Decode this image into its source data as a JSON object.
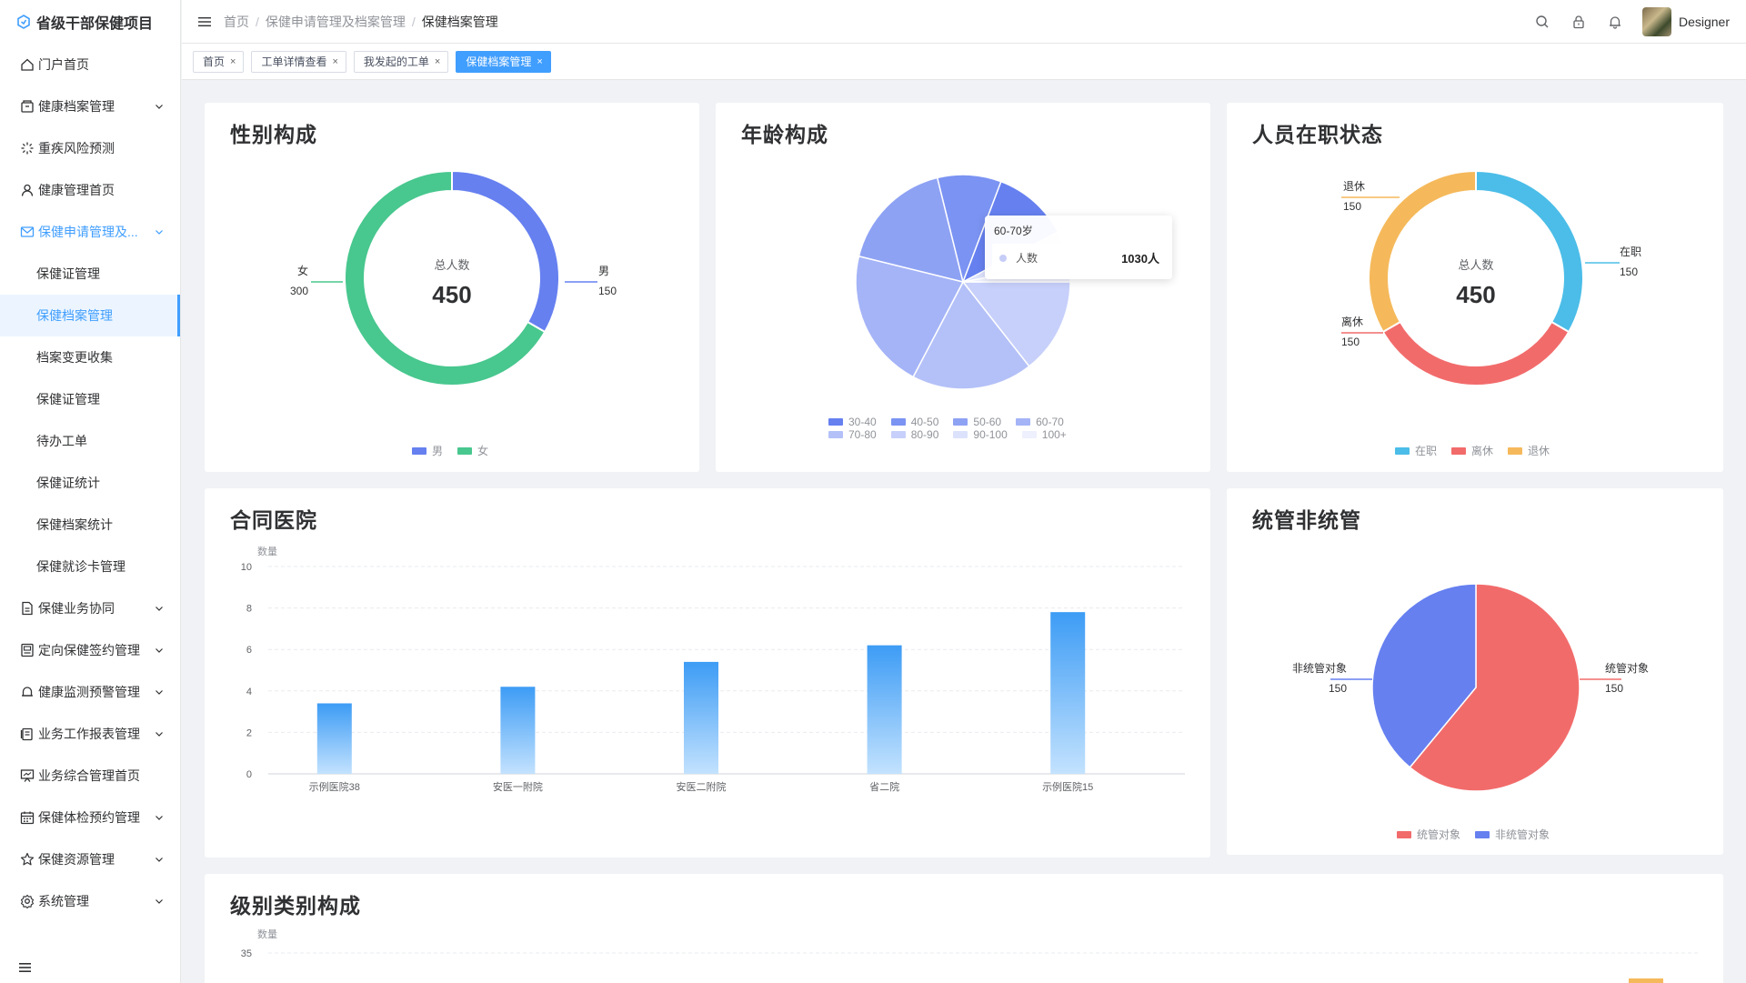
{
  "app": {
    "title": "省级干部保健项目"
  },
  "sidebar": {
    "items": [
      {
        "label": "门户首页",
        "icon": "home-icon",
        "has_children": false
      },
      {
        "label": "健康档案管理",
        "icon": "archive-icon",
        "has_children": true
      },
      {
        "label": "重疾风险预测",
        "icon": "loading-icon",
        "has_children": false
      },
      {
        "label": "健康管理首页",
        "icon": "user-icon",
        "has_children": false
      },
      {
        "label": "保健申请管理及...",
        "icon": "mail-icon",
        "has_children": true,
        "open": true
      }
    ],
    "sub_items": [
      {
        "label": "保健证管理",
        "active": false
      },
      {
        "label": "保健档案管理",
        "active": true
      },
      {
        "label": "档案变更收集",
        "active": false
      },
      {
        "label": "保健证管理",
        "active": false
      },
      {
        "label": "待办工单",
        "active": false
      },
      {
        "label": "保健证统计",
        "active": false
      },
      {
        "label": "保健档案统计",
        "active": false
      },
      {
        "label": "保健就诊卡管理",
        "active": false
      }
    ],
    "items_after": [
      {
        "label": "保健业务协同",
        "icon": "document-icon"
      },
      {
        "label": "定向保健签约管理",
        "icon": "contract-icon"
      },
      {
        "label": "健康监测预警管理",
        "icon": "bell-icon"
      },
      {
        "label": "业务工作报表管理",
        "icon": "report-icon"
      },
      {
        "label": "业务综合管理首页",
        "icon": "presentation-icon",
        "no_chevron": true
      },
      {
        "label": "保健体检预约管理",
        "icon": "calendar-icon"
      },
      {
        "label": "保健资源管理",
        "icon": "star-icon"
      },
      {
        "label": "系统管理",
        "icon": "settings-icon"
      }
    ]
  },
  "header": {
    "breadcrumb": [
      "首页",
      "保健申请管理及档案管理",
      "保健档案管理"
    ],
    "username": "Designer"
  },
  "tags": [
    {
      "label": "首页",
      "active": false
    },
    {
      "label": "工单详情查看",
      "active": false
    },
    {
      "label": "我发起的工单",
      "active": false
    },
    {
      "label": "保健档案管理",
      "active": true
    }
  ],
  "colors": {
    "accent": "#409eff",
    "male": "#6680f0",
    "female": "#48c78e",
    "employed": "#4bbde8",
    "resigned": "#f26b6b",
    "retired": "#f5b95b"
  },
  "cards": {
    "gender": {
      "title": "性别构成"
    },
    "age": {
      "title": "年龄构成"
    },
    "status": {
      "title": "人员在职状态"
    },
    "hospital": {
      "title": "合同医院"
    },
    "managed": {
      "title": "统管非统管"
    },
    "level": {
      "title": "级别类别构成"
    }
  },
  "tooltip": {
    "title": "60-70岁",
    "label": "人数",
    "value": "1030人"
  },
  "chart_data": [
    {
      "type": "pie",
      "variant": "donut",
      "title": "性别构成",
      "center_label": "总人数",
      "center_value": "450",
      "slices": [
        {
          "name": "男",
          "value": 150,
          "color": "#6680f0"
        },
        {
          "name": "女",
          "value": 300,
          "color": "#48c78e"
        }
      ],
      "legend": [
        "男",
        "女"
      ]
    },
    {
      "type": "pie",
      "title": "年龄构成",
      "slices": [
        {
          "name": "30-40",
          "value": 12,
          "color": "#6680f0"
        },
        {
          "name": "40-50",
          "value": 10,
          "color": "#7b93f2"
        },
        {
          "name": "50-60",
          "value": 18,
          "color": "#8ea2f4"
        },
        {
          "name": "60-70",
          "value": 22,
          "color": "#a5b4f7"
        },
        {
          "name": "70-80",
          "value": 19,
          "color": "#b4c1f8"
        },
        {
          "name": "80-90",
          "value": 15,
          "color": "#c7d0fa"
        },
        {
          "name": "90-100",
          "value": 5,
          "color": "#dde2fc"
        },
        {
          "name": "100+",
          "value": 3,
          "color": "#eef0fd"
        }
      ],
      "legend": [
        "30-40",
        "40-50",
        "50-60",
        "60-70",
        "70-80",
        "80-90",
        "90-100",
        "100+"
      ]
    },
    {
      "type": "pie",
      "variant": "donut",
      "title": "人员在职状态",
      "center_label": "总人数",
      "center_value": "450",
      "slices": [
        {
          "name": "在职",
          "value": 150,
          "color": "#4bbde8"
        },
        {
          "name": "离休",
          "value": 150,
          "color": "#f26b6b"
        },
        {
          "name": "退休",
          "value": 150,
          "color": "#f5b95b"
        }
      ],
      "legend": [
        "在职",
        "离休",
        "退休"
      ]
    },
    {
      "type": "bar",
      "title": "合同医院",
      "ylabel": "数量",
      "categories": [
        "示例医院38",
        "安医一附院",
        "安医二附院",
        "省二院",
        "示例医院15"
      ],
      "values": [
        3.4,
        4.2,
        5.4,
        6.2,
        7.8
      ],
      "ylim": [
        0,
        10
      ],
      "yticks": [
        0,
        2,
        4,
        6,
        8,
        10
      ],
      "grid": true
    },
    {
      "type": "pie",
      "title": "统管非统管",
      "slices": [
        {
          "name": "统管对象",
          "value": 150,
          "color": "#f26b6b"
        },
        {
          "name": "非统管对象",
          "value": 150,
          "color": "#6680f0"
        }
      ],
      "legend": [
        "统管对象",
        "非统管对象"
      ]
    },
    {
      "type": "bar",
      "title": "级别类别构成",
      "ylabel": "数量",
      "yticks": [
        35
      ],
      "grid": true
    }
  ]
}
